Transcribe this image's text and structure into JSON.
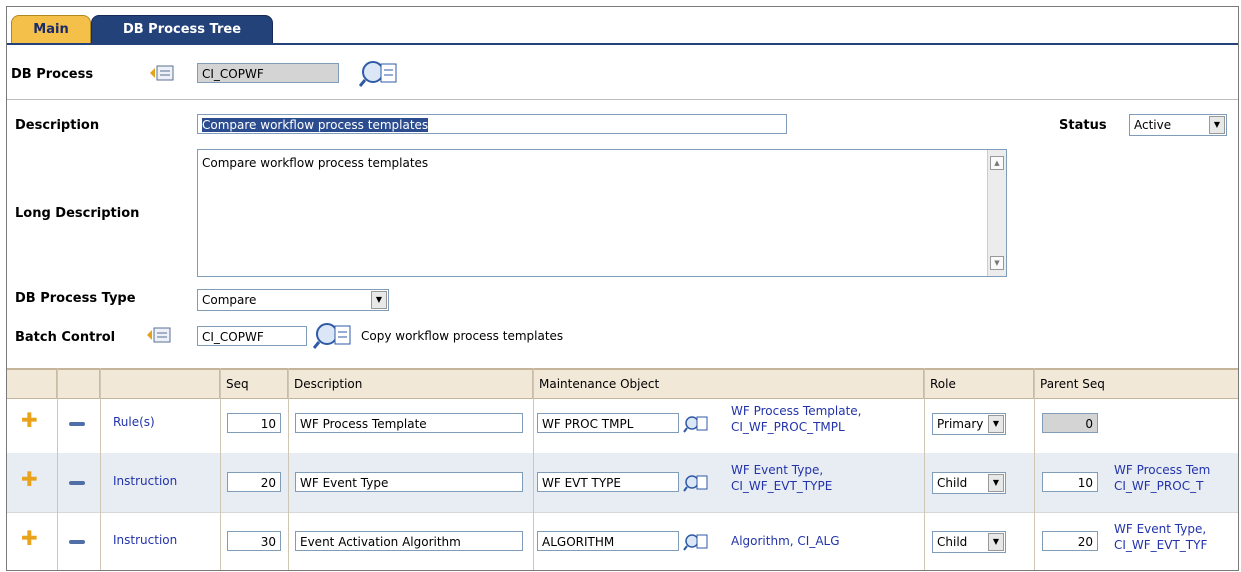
{
  "tabs": [
    {
      "label": "Main"
    },
    {
      "label": "DB Process Tree"
    }
  ],
  "form": {
    "db_process_label": "DB Process",
    "db_process_value": "CI_COPWF",
    "description_label": "Description",
    "description_value": "Compare workflow process templates",
    "status_label": "Status",
    "status_value": "Active",
    "long_description_label": "Long Description",
    "long_description_value": "Compare workflow process templates",
    "db_process_type_label": "DB Process Type",
    "db_process_type_value": "Compare",
    "batch_control_label": "Batch Control",
    "batch_control_value": "CI_COPWF",
    "batch_control_desc": "Copy workflow process templates"
  },
  "grid": {
    "headers": {
      "seq": "Seq",
      "description": "Description",
      "mo": "Maintenance Object",
      "role": "Role",
      "parent_seq": "Parent Seq"
    },
    "rows": [
      {
        "type": "Rule(s)",
        "seq": "10",
        "description": "WF Process Template",
        "mo": "WF PROC TMPL",
        "mo_link1": "WF Process Template,",
        "mo_link2": "CI_WF_PROC_TMPL",
        "role": "Primary",
        "parent_seq": "0",
        "parent_link1": "",
        "parent_link2": ""
      },
      {
        "type": "Instruction",
        "seq": "20",
        "description": "WF Event Type",
        "mo": "WF EVT TYPE",
        "mo_link1": "WF Event Type,",
        "mo_link2": "CI_WF_EVT_TYPE",
        "role": "Child",
        "parent_seq": "10",
        "parent_link1": "WF Process Tem",
        "parent_link2": "CI_WF_PROC_T"
      },
      {
        "type": "Instruction",
        "seq": "30",
        "description": "Event Activation Algorithm",
        "mo": "ALGORITHM",
        "mo_link1": "Algorithm, CI_ALG",
        "mo_link2": "",
        "role": "Child",
        "parent_seq": "20",
        "parent_link1": "WF Event Type,",
        "parent_link2": "CI_WF_EVT_TYF"
      }
    ]
  }
}
